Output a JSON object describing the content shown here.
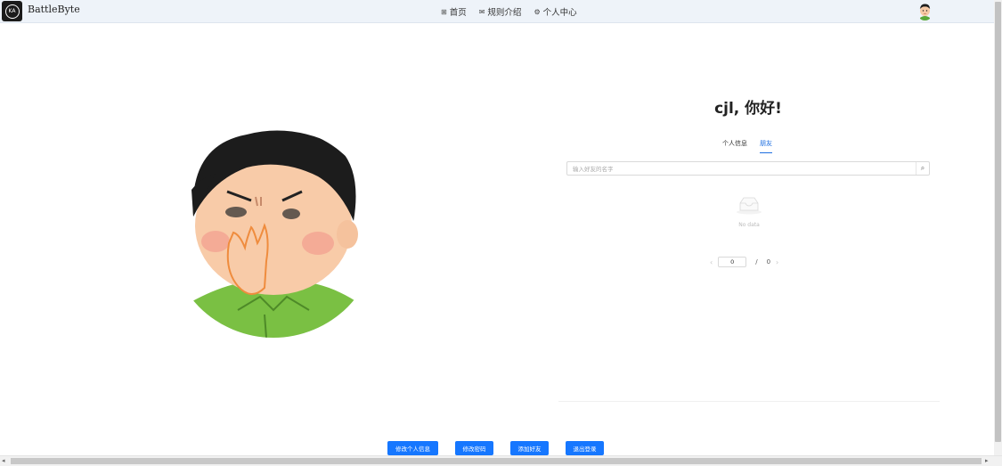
{
  "header": {
    "brand": "BattleByte",
    "nav": [
      {
        "icon": "grid-icon",
        "label": "首页"
      },
      {
        "icon": "mail-icon",
        "label": "规则介绍"
      },
      {
        "icon": "gear-icon",
        "label": "个人中心"
      }
    ]
  },
  "profile": {
    "greeting": "cjl, 你好!",
    "tabs": [
      {
        "label": "个人信息",
        "active": false
      },
      {
        "label": "朋友",
        "active": true
      }
    ],
    "search": {
      "placeholder": "输入好友的名字"
    },
    "empty_text": "No data",
    "pagination": {
      "current": "0",
      "separator": "/",
      "total": "0"
    }
  },
  "actions": {
    "edit_info": "修改个人信息",
    "change_password": "修改密码",
    "add_friend": "添加好友",
    "logout": "退出登录"
  },
  "colors": {
    "accent": "#1677ff",
    "topbar": "#eef3f9"
  }
}
